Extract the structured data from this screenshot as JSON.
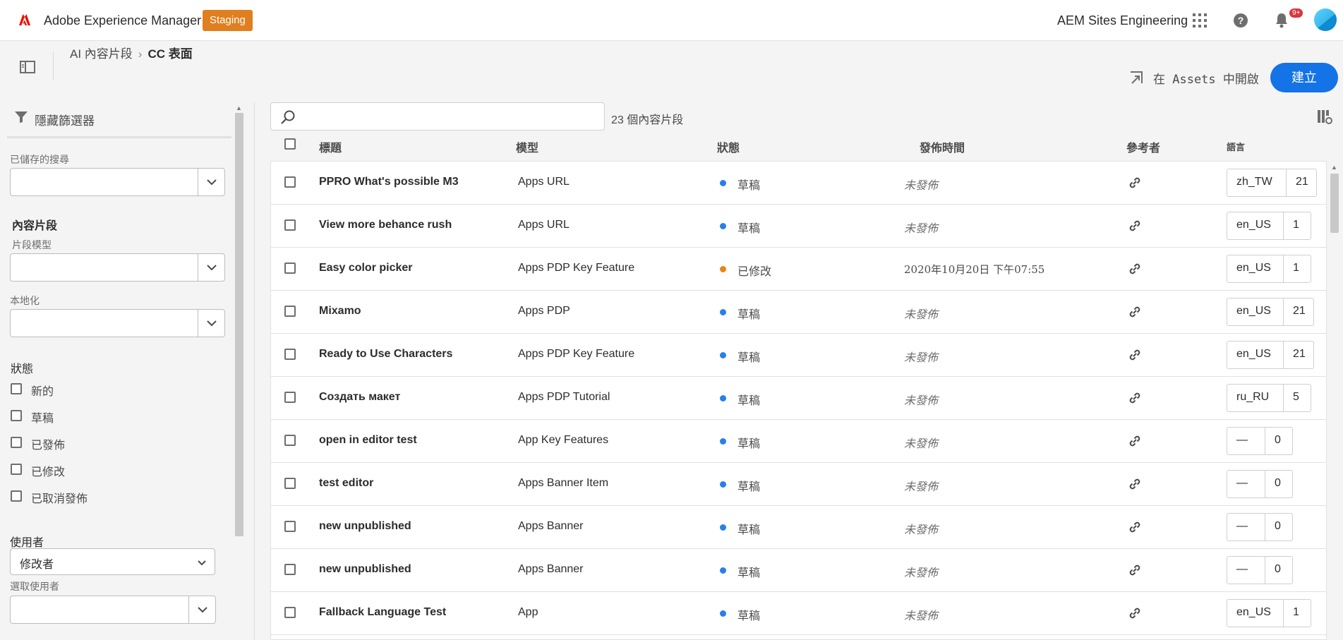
{
  "header": {
    "app_title": "Adobe Experience Manager",
    "env_badge": "Staging",
    "org_name": "AEM Sites Engineering",
    "notif_count": "9+",
    "accent": "#1473e6",
    "badge_color": "#e07f1f"
  },
  "breadcrumb": {
    "parent": "AI 內容片段",
    "current": "CC 表面"
  },
  "actions": {
    "open_in_assets": "在 Assets 中開啟",
    "create": "建立"
  },
  "filters": {
    "hide_label": "隱藏篩選器",
    "saved_search_label": "已儲存的搜尋",
    "section_title": "內容片段",
    "model_label": "片段模型",
    "localization_label": "本地化",
    "status_title": "狀態",
    "status_options": [
      "新的",
      "草稿",
      "已發佈",
      "已修改",
      "已取消發佈"
    ],
    "user_title": "使用者",
    "user_select": "修改者",
    "choose_user_label": "選取使用者"
  },
  "list": {
    "search_placeholder": "",
    "count_label": "23 個內容片段",
    "columns": [
      "標題",
      "模型",
      "狀態",
      "發佈時間",
      "參考者",
      "語言"
    ],
    "rows": [
      {
        "title": "PPRO What's possible M3",
        "model": "Apps URL",
        "status": "草稿",
        "status_color": "#2680eb",
        "published": "未發佈",
        "lang": "zh_TW",
        "num": "21"
      },
      {
        "title": "View more behance rush",
        "model": "Apps URL",
        "status": "草稿",
        "status_color": "#2680eb",
        "published": "未發佈",
        "lang": "en_US",
        "num": "1"
      },
      {
        "title": "Easy color picker",
        "model": "Apps PDP Key Feature",
        "status": "已修改",
        "status_color": "#e68619",
        "published": "2020年10月20日 下午07:55",
        "lang": "en_US",
        "num": "1"
      },
      {
        "title": "Mixamo",
        "model": "Apps PDP",
        "status": "草稿",
        "status_color": "#2680eb",
        "published": "未發佈",
        "lang": "en_US",
        "num": "21"
      },
      {
        "title": "Ready to Use Characters",
        "model": "Apps PDP Key Feature",
        "status": "草稿",
        "status_color": "#2680eb",
        "published": "未發佈",
        "lang": "en_US",
        "num": "21"
      },
      {
        "title": "Создать макет",
        "model": "Apps PDP Tutorial",
        "status": "草稿",
        "status_color": "#2680eb",
        "published": "未發佈",
        "lang": "ru_RU",
        "num": "5"
      },
      {
        "title": "open in editor test",
        "model": "App Key Features",
        "status": "草稿",
        "status_color": "#2680eb",
        "published": "未發佈",
        "lang": "—",
        "num": "0"
      },
      {
        "title": "test editor",
        "model": "Apps Banner Item",
        "status": "草稿",
        "status_color": "#2680eb",
        "published": "未發佈",
        "lang": "—",
        "num": "0"
      },
      {
        "title": "new unpublished",
        "model": "Apps Banner",
        "status": "草稿",
        "status_color": "#2680eb",
        "published": "未發佈",
        "lang": "—",
        "num": "0"
      },
      {
        "title": "new unpublished",
        "model": "Apps Banner",
        "status": "草稿",
        "status_color": "#2680eb",
        "published": "未發佈",
        "lang": "—",
        "num": "0"
      },
      {
        "title": "Fallback Language Test",
        "model": "App",
        "status": "草稿",
        "status_color": "#2680eb",
        "published": "未發佈",
        "lang": "en_US",
        "num": "1"
      }
    ]
  }
}
